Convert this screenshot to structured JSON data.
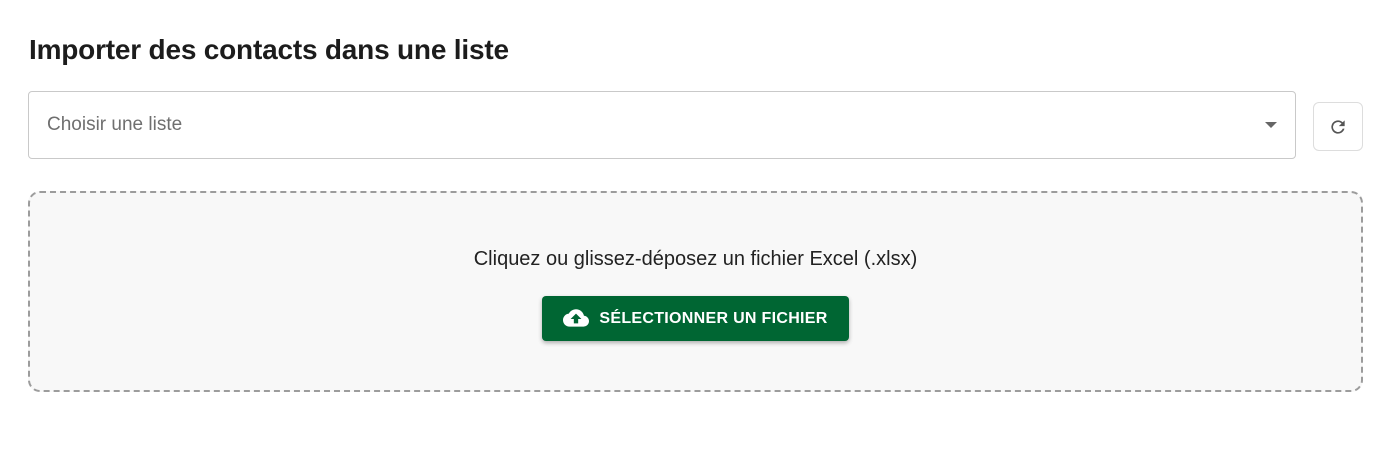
{
  "header": {
    "title": "Importer des contacts dans une liste"
  },
  "list_select": {
    "placeholder": "Choisir une liste",
    "icon": "chevron-down-icon"
  },
  "refresh": {
    "icon": "refresh-icon"
  },
  "dropzone": {
    "instruction": "Cliquez ou glissez-déposez un fichier Excel (.xlsx)",
    "button_label": "SÉLECTIONNER UN FICHIER",
    "button_icon": "cloud-upload-icon",
    "button_color": "#006633"
  }
}
